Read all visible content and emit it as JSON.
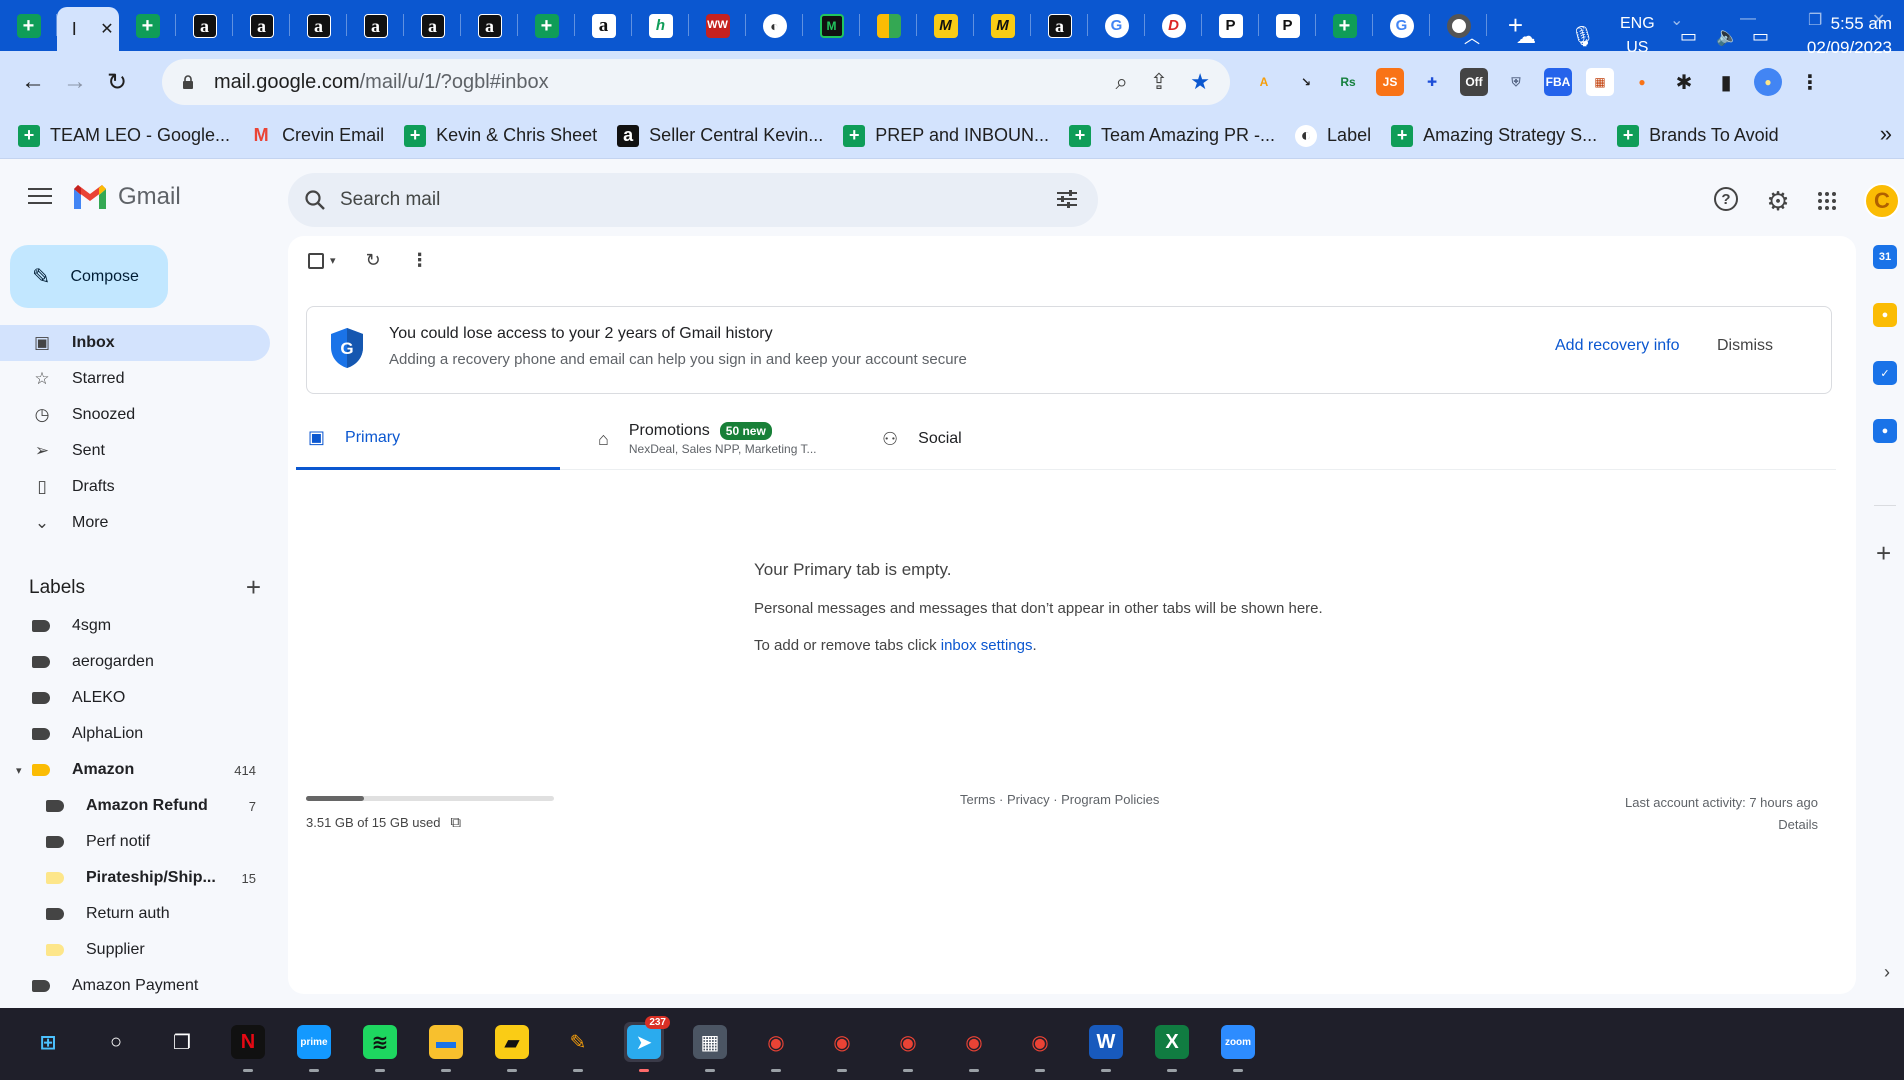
{
  "browser": {
    "tabs": [
      {
        "icon": "google-sheets-icon",
        "glyph": "+",
        "style": "sheet"
      },
      {
        "icon": "active-tab-icon",
        "glyph": "I",
        "style": "active",
        "close": "✕"
      },
      {
        "icon": "google-sheets-icon",
        "glyph": "+",
        "style": "sheet"
      },
      {
        "icon": "amazon-icon",
        "glyph": "a",
        "style": "amzd"
      },
      {
        "icon": "amazon-icon",
        "glyph": "a",
        "style": "amzd"
      },
      {
        "icon": "amazon-icon",
        "glyph": "a",
        "style": "amzd"
      },
      {
        "icon": "amazon-icon",
        "glyph": "a",
        "style": "amzd"
      },
      {
        "icon": "amazon-icon",
        "glyph": "a",
        "style": "amzd"
      },
      {
        "icon": "amazon-icon",
        "glyph": "a",
        "style": "amzd"
      },
      {
        "icon": "google-sheets-icon",
        "glyph": "+",
        "style": "sheet"
      },
      {
        "icon": "amazon-icon",
        "glyph": "a",
        "style": "amz"
      },
      {
        "icon": "h-logo-icon",
        "glyph": "h",
        "style": "h"
      },
      {
        "icon": "ww-logo-icon",
        "glyph": "WW",
        "style": "ww"
      },
      {
        "icon": "circle-logo-icon",
        "glyph": "◐",
        "style": "circ"
      },
      {
        "icon": "m-logo-icon",
        "glyph": "M",
        "style": "m"
      },
      {
        "icon": "grid-logo-icon",
        "glyph": "",
        "style": "grid4"
      },
      {
        "icon": "m-italic-logo-icon",
        "glyph": "M",
        "style": "mm"
      },
      {
        "icon": "m-italic-logo-icon",
        "glyph": "M",
        "style": "mm"
      },
      {
        "icon": "amazon-icon",
        "glyph": "a",
        "style": "amzd"
      },
      {
        "icon": "google-icon",
        "glyph": "G",
        "style": "g"
      },
      {
        "icon": "d-logo-icon",
        "glyph": "D",
        "style": "d"
      },
      {
        "icon": "p-logo-icon",
        "glyph": "P",
        "style": "p"
      },
      {
        "icon": "p-logo-icon",
        "glyph": "P",
        "style": "p"
      },
      {
        "icon": "google-sheets-icon",
        "glyph": "+",
        "style": "sheet"
      },
      {
        "icon": "google-icon",
        "glyph": "G",
        "style": "g"
      },
      {
        "icon": "chrome-icon",
        "glyph": "",
        "style": "chrome"
      }
    ],
    "new_tab_glyph": "+",
    "address": {
      "host": "mail.google.com",
      "path": "/mail/u/1/?ogbl#inbox"
    },
    "bookmarks": [
      {
        "label": "TEAM LEO - Google...",
        "icon": "google-sheets-icon",
        "glyph": "+",
        "bg": "#0f9d58",
        "fg": "#ffffff"
      },
      {
        "label": "Crevin Email",
        "icon": "gmail-icon",
        "glyph": "M",
        "bg": "transparent",
        "fg": "#ea4335"
      },
      {
        "label": "Kevin & Chris Sheet",
        "icon": "google-sheets-icon",
        "glyph": "+",
        "bg": "#0f9d58",
        "fg": "#ffffff"
      },
      {
        "label": "Seller Central Kevin...",
        "icon": "amazon-icon",
        "glyph": "a",
        "bg": "#111111",
        "fg": "#ffffff"
      },
      {
        "label": "PREP and INBOUN...",
        "icon": "google-sheets-icon",
        "glyph": "+",
        "bg": "#0f9d58",
        "fg": "#ffffff"
      },
      {
        "label": "Team Amazing PR -...",
        "icon": "google-sheets-icon",
        "glyph": "+",
        "bg": "#0f9d58",
        "fg": "#ffffff"
      },
      {
        "label": "Label",
        "icon": "circle-logo-icon",
        "glyph": "◐",
        "bg": "#ffffff",
        "fg": "#333333"
      },
      {
        "label": "Amazing Strategy S...",
        "icon": "google-sheets-icon",
        "glyph": "+",
        "bg": "#0f9d58",
        "fg": "#ffffff"
      },
      {
        "label": "Brands To Avoid",
        "icon": "google-sheets-icon",
        "glyph": "+",
        "bg": "#0f9d58",
        "fg": "#ffffff"
      }
    ],
    "bookmarks_more": "»",
    "extensions": [
      {
        "icon": "scout-extension-icon",
        "glyph": "A",
        "bg": "transparent",
        "fg": "#f59e0b"
      },
      {
        "icon": "arrow-extension-icon",
        "glyph": "↘",
        "bg": "transparent",
        "fg": "#222"
      },
      {
        "icon": "rs-extension-icon",
        "glyph": "Rs",
        "bg": "transparent",
        "fg": "#15803d"
      },
      {
        "icon": "js-extension-icon",
        "glyph": "JS",
        "bg": "#f97316",
        "fg": "#fff"
      },
      {
        "icon": "plus-extension-icon",
        "glyph": "✚",
        "bg": "transparent",
        "fg": "#1d4ed8"
      },
      {
        "icon": "off-extension-icon",
        "glyph": "Off",
        "bg": "#444",
        "fg": "#fff"
      },
      {
        "icon": "shield-extension-icon",
        "glyph": "⛨",
        "bg": "transparent",
        "fg": "#5b6b8a"
      },
      {
        "icon": "fba-extension-icon",
        "glyph": "FBA",
        "bg": "#2563eb",
        "fg": "#fff"
      },
      {
        "icon": "calendar-extension-icon",
        "glyph": "▦",
        "bg": "#fff",
        "fg": "#c2410c"
      },
      {
        "icon": "orange-circle-extension-icon",
        "glyph": "●",
        "bg": "transparent",
        "fg": "#f97316"
      },
      {
        "icon": "puzzle-icon",
        "glyph": "✱",
        "bg": "transparent",
        "fg": "#1f1f1f"
      },
      {
        "icon": "side-panel-icon",
        "glyph": "▮",
        "bg": "transparent",
        "fg": "#1f1f1f"
      },
      {
        "icon": "profile-icon",
        "glyph": "●",
        "bg": "#4285f4",
        "fg": "#fde68a"
      },
      {
        "icon": "kebab-menu-icon",
        "glyph": "⋮",
        "bg": "transparent",
        "fg": "#1f1f1f"
      }
    ]
  },
  "gmail": {
    "logo_text": "Gmail",
    "search_placeholder": "Search mail",
    "avatar_letter": "C",
    "compose_label": "Compose",
    "nav": [
      {
        "label": "Inbox",
        "icon": "inbox-icon",
        "glyph": "▣",
        "active": true
      },
      {
        "label": "Starred",
        "icon": "star-icon",
        "glyph": "☆"
      },
      {
        "label": "Snoozed",
        "icon": "clock-icon",
        "glyph": "◷"
      },
      {
        "label": "Sent",
        "icon": "send-icon",
        "glyph": "➢"
      },
      {
        "label": "Drafts",
        "icon": "draft-icon",
        "glyph": "▯"
      },
      {
        "label": "More",
        "icon": "chevron-down-icon",
        "glyph": "⌄"
      }
    ],
    "labels_title": "Labels",
    "labels": [
      {
        "label": "4sgm",
        "color": "#444444",
        "indent": 0
      },
      {
        "label": "aerogarden",
        "color": "#444444",
        "indent": 0
      },
      {
        "label": "ALEKO",
        "color": "#444444",
        "indent": 0
      },
      {
        "label": "AlphaLion",
        "color": "#444444",
        "indent": 0
      },
      {
        "label": "Amazon",
        "color": "#fbbc04",
        "indent": 0,
        "bold": true,
        "count": "414",
        "expanded": true
      },
      {
        "label": "Amazon Refund",
        "color": "#444444",
        "indent": 1,
        "bold": true,
        "count": "7"
      },
      {
        "label": "Perf notif",
        "color": "#444444",
        "indent": 1
      },
      {
        "label": "Pirateship/Ship...",
        "color": "#fde68a",
        "indent": 1,
        "bold": true,
        "count": "15"
      },
      {
        "label": "Return auth",
        "color": "#444444",
        "indent": 1
      },
      {
        "label": "Supplier",
        "color": "#fde68a",
        "indent": 1
      },
      {
        "label": "Amazon Payment",
        "color": "#444444",
        "indent": 0
      }
    ],
    "banner": {
      "title": "You could lose access to your 2 years of Gmail history",
      "subtitle": "Adding a recovery phone and email can help you sign in and keep your account secure",
      "action": "Add recovery info",
      "dismiss": "Dismiss"
    },
    "tabs": {
      "primary": "Primary",
      "promotions": "Promotions",
      "promotions_badge": "50 new",
      "promotions_sub": "NexDeal, Sales NPP, Marketing T...",
      "social": "Social"
    },
    "empty": {
      "heading": "Your Primary tab is empty.",
      "body": "Personal messages and messages that don’t appear in other tabs will be shown here.",
      "settings_prefix": "To add or remove tabs click ",
      "settings_link": "inbox settings",
      "settings_suffix": "."
    },
    "storage": {
      "used_fraction": 0.234,
      "text": "3.51 GB of 15 GB used"
    },
    "footer": {
      "terms": "Terms",
      "privacy": "Privacy",
      "policies": "Program Policies",
      "separator": " · "
    },
    "activity": {
      "text": "Last account activity: 7 hours ago",
      "details": "Details"
    }
  },
  "side_apps": [
    {
      "icon": "calendar-icon",
      "glyph": "31",
      "bg": "#1a73e8"
    },
    {
      "icon": "keep-icon",
      "glyph": "●",
      "bg": "#fbbc04"
    },
    {
      "icon": "tasks-icon",
      "glyph": "✓",
      "bg": "#1a73e8"
    },
    {
      "icon": "contacts-icon",
      "glyph": "●",
      "bg": "#1a73e8"
    }
  ],
  "taskbar": {
    "apps": [
      {
        "icon": "windows-start-icon",
        "glyph": "⊞",
        "bg": "transparent",
        "fg": "#4cc2ff"
      },
      {
        "icon": "search-icon",
        "glyph": "○",
        "bg": "transparent",
        "fg": "#ffffff"
      },
      {
        "icon": "task-view-icon",
        "glyph": "❐",
        "bg": "transparent",
        "fg": "#ffffff"
      },
      {
        "icon": "netflix-icon",
        "glyph": "N",
        "bg": "#111111",
        "fg": "#e50914"
      },
      {
        "icon": "prime-video-icon",
        "glyph": "prime",
        "bg": "#1399ff",
        "fg": "#ffffff"
      },
      {
        "icon": "spotify-icon",
        "glyph": "≋",
        "bg": "#1ed760",
        "fg": "#111111"
      },
      {
        "icon": "file-explorer-icon",
        "glyph": "▬",
        "bg": "#f8c02d",
        "fg": "#1a73e8"
      },
      {
        "icon": "sticky-notes-icon",
        "glyph": "▰",
        "bg": "#facc15",
        "fg": "#111111"
      },
      {
        "icon": "paint-icon",
        "glyph": "✎",
        "bg": "transparent",
        "fg": "#f59e0b"
      },
      {
        "icon": "telegram-icon",
        "glyph": "➤",
        "bg": "#2aabee",
        "fg": "#ffffff",
        "badge": "237"
      },
      {
        "icon": "calculator-icon",
        "glyph": "▦",
        "bg": "#4b5563",
        "fg": "#ffffff"
      },
      {
        "icon": "chrome-icon",
        "glyph": "◉",
        "bg": "transparent",
        "fg": "#ea4335"
      },
      {
        "icon": "chrome-icon",
        "glyph": "◉",
        "bg": "transparent",
        "fg": "#ea4335"
      },
      {
        "icon": "chrome-icon",
        "glyph": "◉",
        "bg": "transparent",
        "fg": "#ea4335"
      },
      {
        "icon": "chrome-icon",
        "glyph": "◉",
        "bg": "transparent",
        "fg": "#ea4335"
      },
      {
        "icon": "chrome-icon",
        "glyph": "◉",
        "bg": "transparent",
        "fg": "#ea4335"
      },
      {
        "icon": "word-icon",
        "glyph": "W",
        "bg": "#185abd",
        "fg": "#ffffff"
      },
      {
        "icon": "excel-icon",
        "glyph": "X",
        "bg": "#107c41",
        "fg": "#ffffff"
      },
      {
        "icon": "zoom-icon",
        "glyph": "zoom",
        "bg": "#2d8cff",
        "fg": "#ffffff"
      }
    ],
    "tray_chevron": "︿",
    "lang_top": "ENG",
    "lang_bottom": "US",
    "time": "5:55 am",
    "date": "02/09/2023"
  }
}
